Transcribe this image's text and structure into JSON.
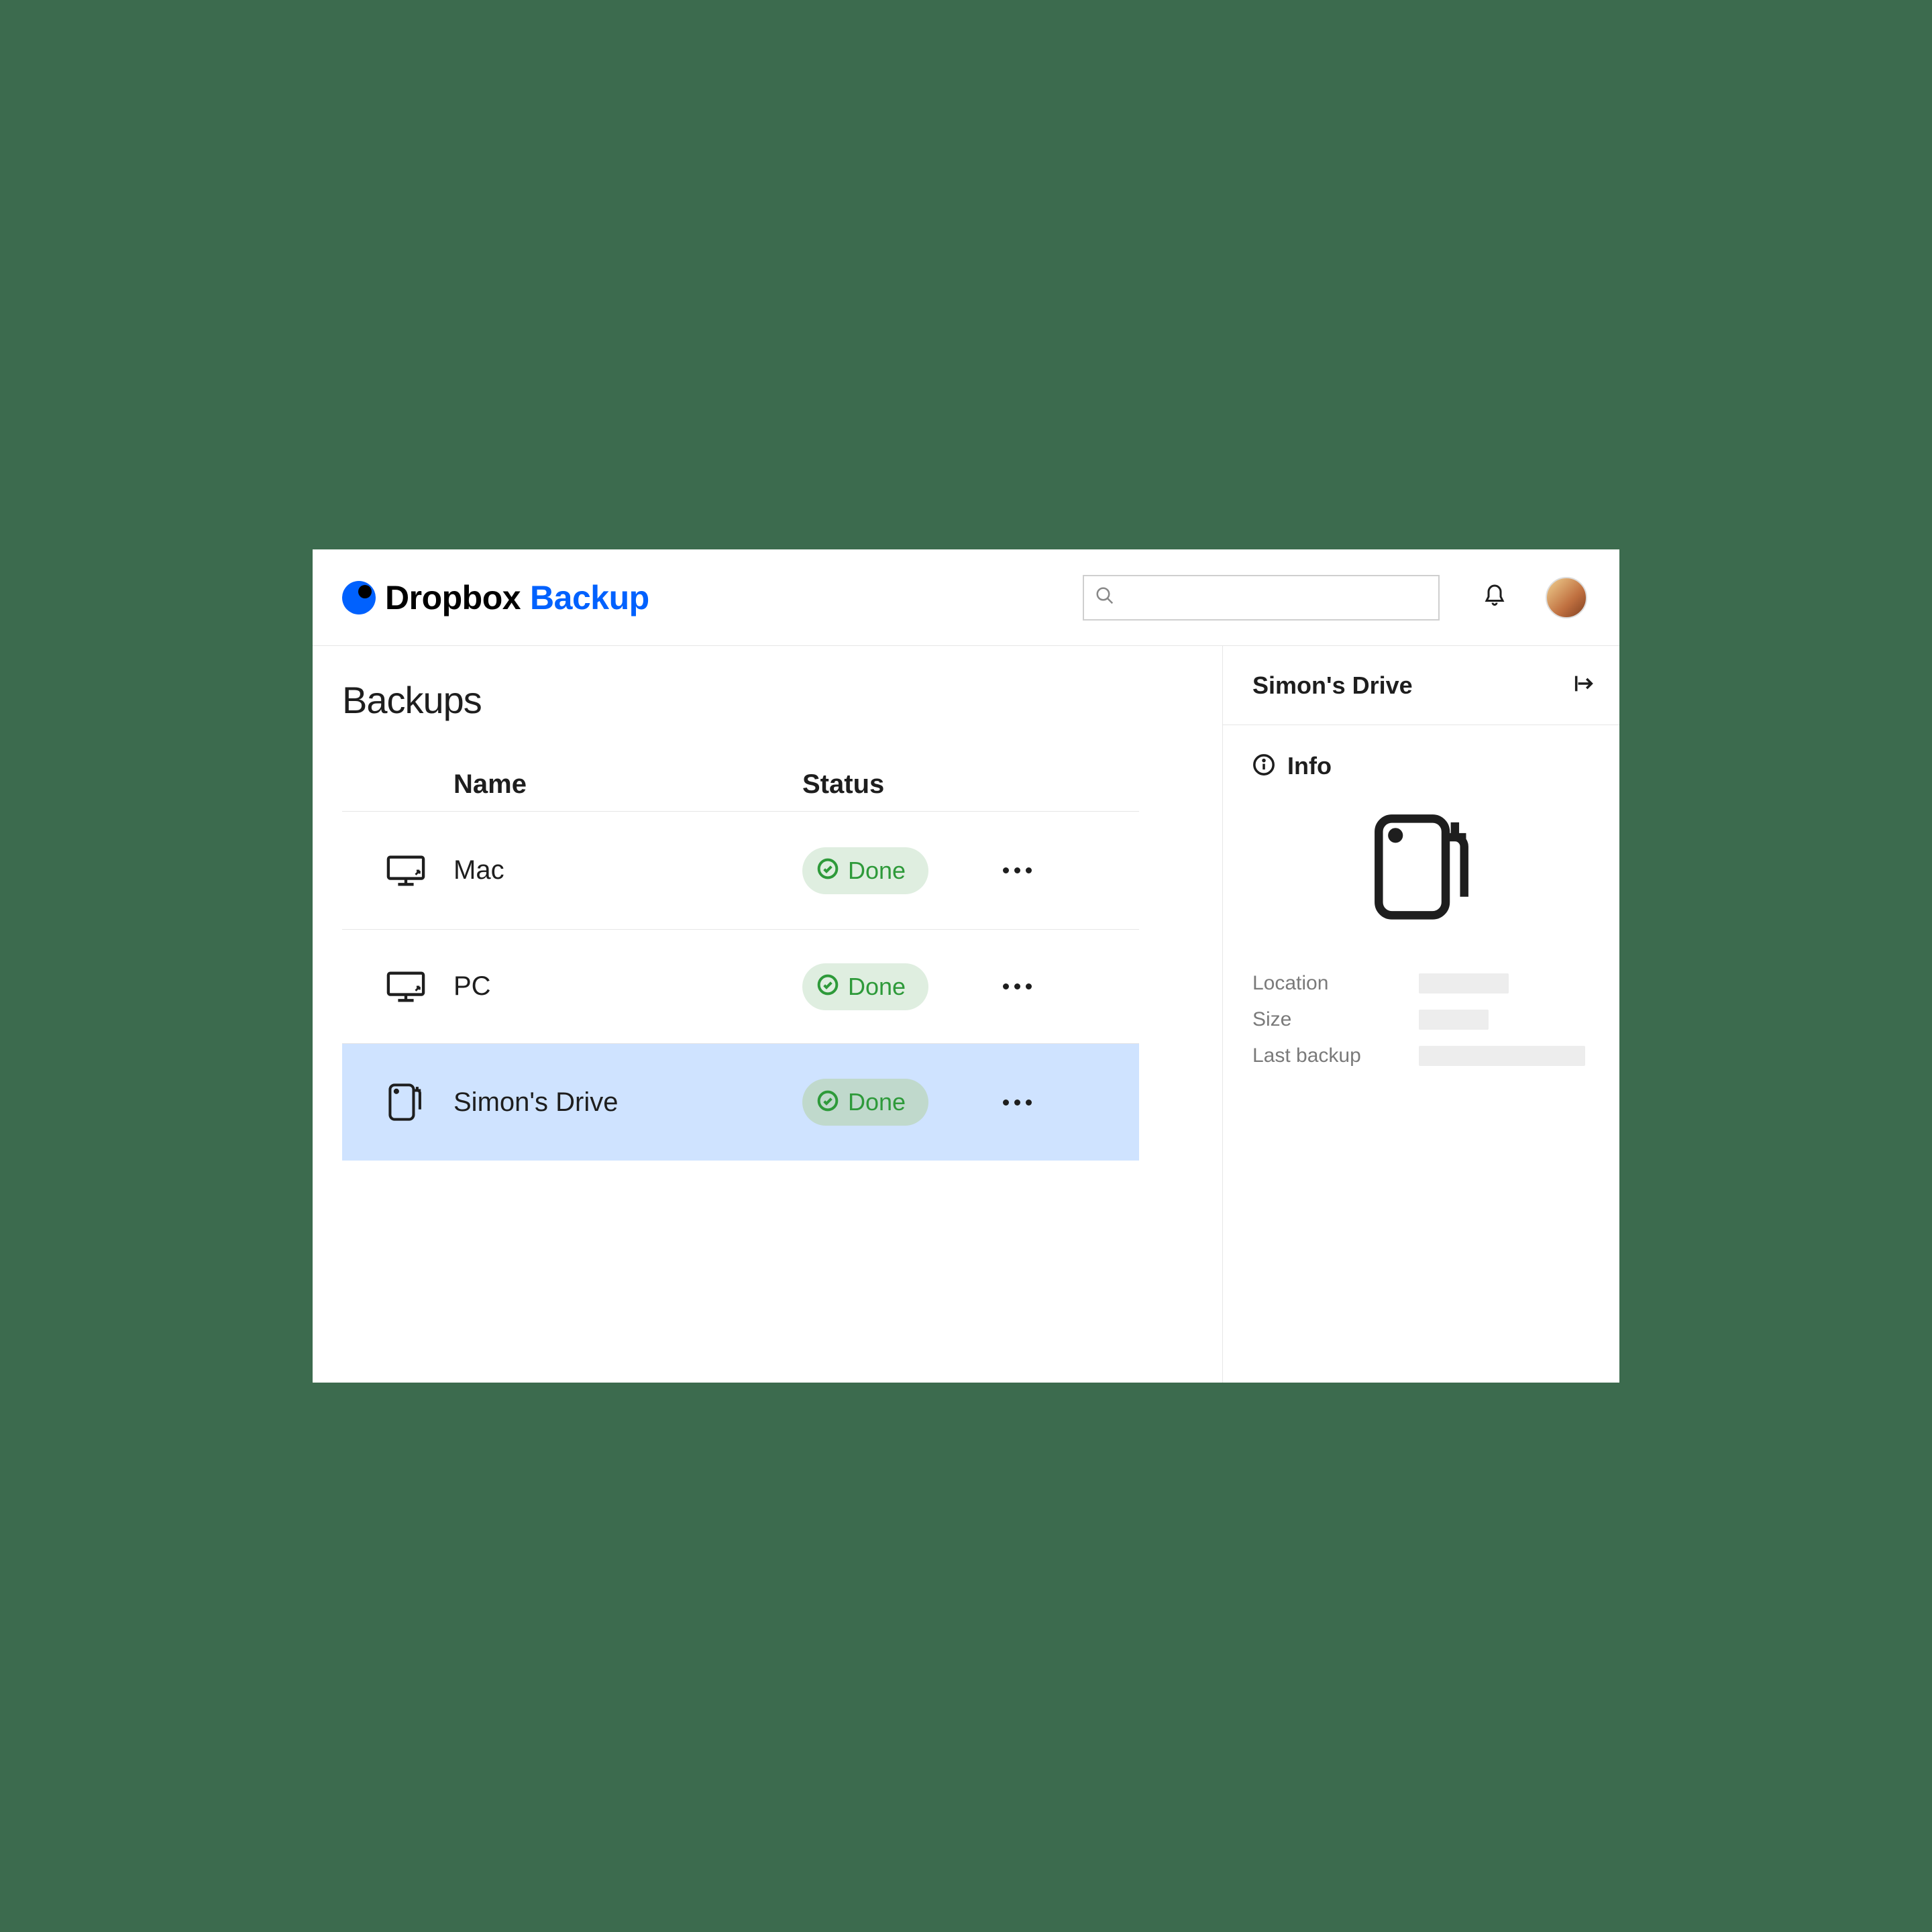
{
  "brand": {
    "word1": "Dropbox",
    "word2": "Backup"
  },
  "page": {
    "title": "Backups"
  },
  "table": {
    "headers": {
      "name": "Name",
      "status": "Status"
    },
    "rows": [
      {
        "name": "Mac",
        "status": "Done",
        "icon": "monitor",
        "selected": false
      },
      {
        "name": "PC",
        "status": "Done",
        "icon": "monitor",
        "selected": false
      },
      {
        "name": "Simon's Drive",
        "status": "Done",
        "icon": "drive",
        "selected": true
      }
    ]
  },
  "panel": {
    "title": "Simon's Drive",
    "info_label": "Info",
    "fields": {
      "location": "Location",
      "size": "Size",
      "last_backup": "Last backup"
    }
  }
}
